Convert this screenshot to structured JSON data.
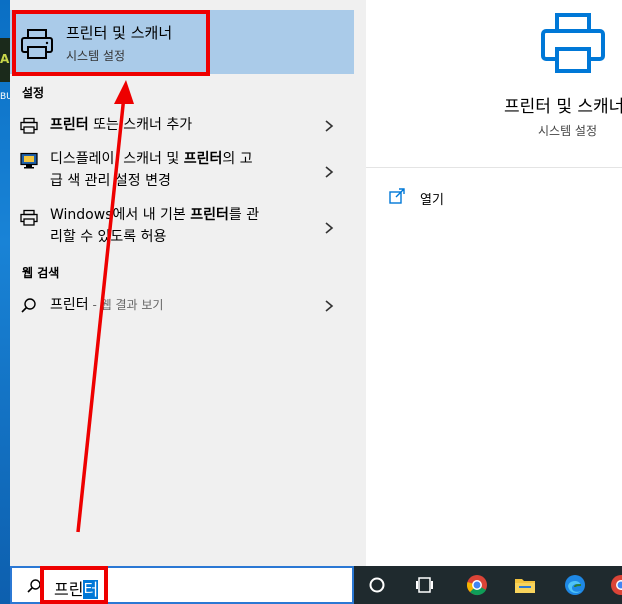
{
  "desktop": {
    "thumb_letter": "A",
    "label": "BU"
  },
  "top_hit": {
    "title": "프린터 및 스캐너",
    "subtitle": "시스템 설정",
    "icon": "printer-icon"
  },
  "sections": {
    "settings_label": "설정",
    "web_label": "웹 검색"
  },
  "results": [
    {
      "icon": "printer-icon",
      "bold": "프린터",
      "rest": " 또는 스캐너 추가",
      "has_chevron": true
    },
    {
      "icon": "monitor-icon",
      "line1_pre": "디스플레이, 스캐너 및 ",
      "line1_bold": "프린터",
      "line1_post": "의 고",
      "line2": "급 색 관리 설정 변경",
      "has_chevron": true
    },
    {
      "icon": "printer-icon",
      "line1_pre": "Windows에서 내 기본 ",
      "line1_bold": "프린터",
      "line1_post": "를 관",
      "line2": "리할 수 있도록 허용",
      "has_chevron": true
    }
  ],
  "web_result": {
    "icon": "search-icon",
    "query": "프린터",
    "suffix": " - 웹 결과 보기"
  },
  "preview": {
    "title": "프린터 및 스캐너",
    "subtitle": "시스템 설정",
    "open_label": "열기",
    "accent": "#0078d7"
  },
  "search": {
    "typed": "프린",
    "selected": "터"
  },
  "taskbar": {
    "items": [
      "cortana-icon",
      "task-view-icon",
      "chrome-icon",
      "file-explorer-icon",
      "edge-icon",
      "chrome-icon"
    ]
  },
  "annotation_color": "#ee0000"
}
